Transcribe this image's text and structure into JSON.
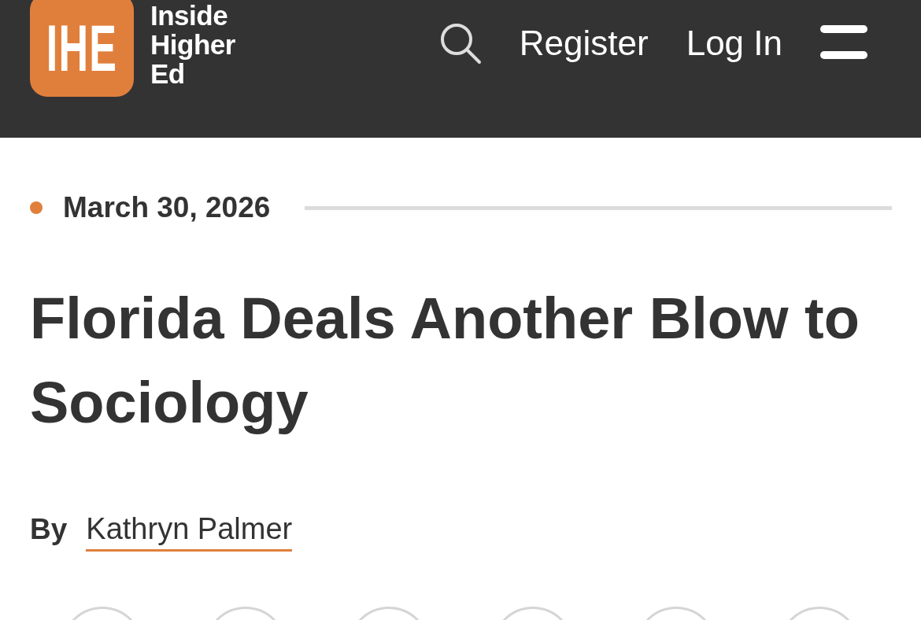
{
  "header": {
    "logo_mark": "IHE",
    "logo_text": [
      "Inside",
      "Higher",
      "Ed"
    ],
    "nav": [
      "Register",
      "Log In"
    ]
  },
  "article": {
    "date": "March 30, 2026",
    "title": "Florida Deals Another Blow to Sociology",
    "byline_label": "By",
    "author": "Kathryn Palmer"
  }
}
